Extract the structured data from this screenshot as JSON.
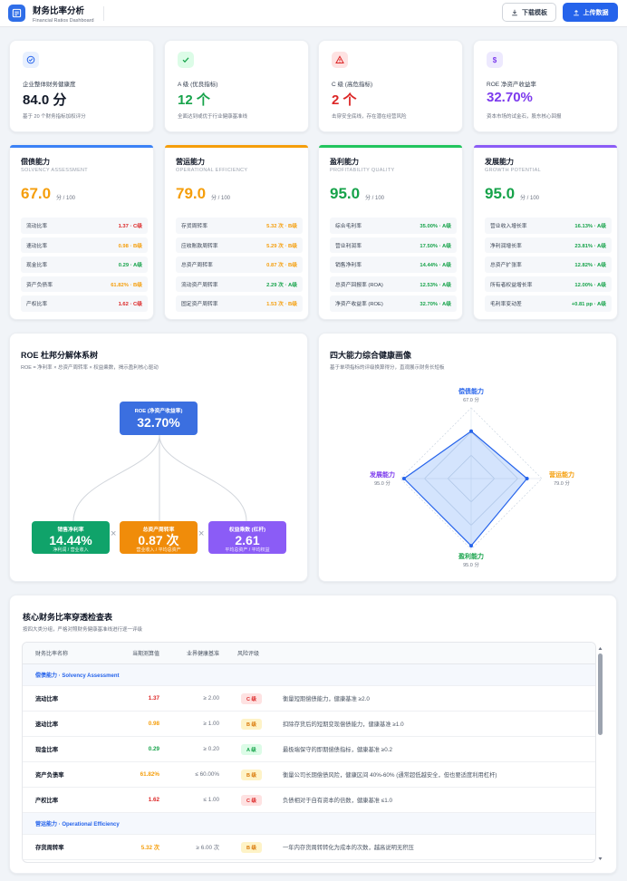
{
  "header": {
    "title": "财务比率分析",
    "subtitle": "Financial Ratios Dashboard",
    "download_label": "下载模板",
    "upload_label": "上传数据"
  },
  "kpis": [
    {
      "label": "企业整体财务健康度",
      "value": "84.0 分",
      "desc": "基于 20 个财务指标加权评分",
      "color": "#111827",
      "bg": "#e8f0fe",
      "icon": "check-circle-icon"
    },
    {
      "label": "A 级 (优良指标)",
      "value": "12 个",
      "desc": "全面达到或优于行业健康基准线",
      "color": "#16a34a",
      "bg": "#dcfce7",
      "icon": "check-icon"
    },
    {
      "label": "C 级 (高危指标)",
      "value": "2 个",
      "desc": "击穿安全底线，存在潜在经营风险",
      "color": "#dc2626",
      "bg": "#fee2e2",
      "icon": "warning-icon"
    },
    {
      "label": "ROE 净资产收益率",
      "value": "32.70%",
      "desc": "资本市场的试金石，股东核心回报",
      "color": "#7c3aed",
      "bg": "#ede9fe",
      "icon": "dollar-icon"
    }
  ],
  "dimensions": [
    {
      "name": "偿债能力",
      "en": "SOLVENCY ASSESSMENT",
      "score": "67.0",
      "per": "分 / 100",
      "color": "#f59e0b",
      "top": "#3b82f6",
      "rows": [
        {
          "name": "流动比率",
          "value": "1.37 · C级",
          "grade": "C"
        },
        {
          "name": "速动比率",
          "value": "0.98 · B级",
          "grade": "B"
        },
        {
          "name": "现金比率",
          "value": "0.29 · A级",
          "grade": "A"
        },
        {
          "name": "资产负债率",
          "value": "61.82% · B级",
          "grade": "B"
        },
        {
          "name": "产权比率",
          "value": "1.62 · C级",
          "grade": "C"
        }
      ]
    },
    {
      "name": "营运能力",
      "en": "OPERATIONAL EFFICIENCY",
      "score": "79.0",
      "per": "分 / 100",
      "color": "#f59e0b",
      "top": "#f59e0b",
      "rows": [
        {
          "name": "存货周转率",
          "value": "5.32 次 · B级",
          "grade": "B"
        },
        {
          "name": "应收账款周转率",
          "value": "5.29 次 · B级",
          "grade": "B"
        },
        {
          "name": "总资产周转率",
          "value": "0.87 次 · B级",
          "grade": "B"
        },
        {
          "name": "流动资产周转率",
          "value": "2.29 次 · A级",
          "grade": "A"
        },
        {
          "name": "固定资产周转率",
          "value": "1.53 次 · B级",
          "grade": "B"
        }
      ]
    },
    {
      "name": "盈利能力",
      "en": "PROFITABILITY QUALITY",
      "score": "95.0",
      "per": "分 / 100",
      "color": "#16a34a",
      "top": "#22c55e",
      "rows": [
        {
          "name": "综合毛利率",
          "value": "35.00% · A级",
          "grade": "A"
        },
        {
          "name": "营业利润率",
          "value": "17.50% · A级",
          "grade": "A"
        },
        {
          "name": "销售净利率",
          "value": "14.44% · A级",
          "grade": "A"
        },
        {
          "name": "总资产回报率 (ROA)",
          "value": "12.53% · A级",
          "grade": "A"
        },
        {
          "name": "净资产收益率 (ROE)",
          "value": "32.70% · A级",
          "grade": "A"
        }
      ]
    },
    {
      "name": "发展能力",
      "en": "GROWTH POTENTIAL",
      "score": "95.0",
      "per": "分 / 100",
      "color": "#16a34a",
      "top": "#8b5cf6",
      "rows": [
        {
          "name": "营业收入增长率",
          "value": "16.13% · A级",
          "grade": "A"
        },
        {
          "name": "净利润增长率",
          "value": "23.81% · A级",
          "grade": "A"
        },
        {
          "name": "总资产扩张率",
          "value": "12.82% · A级",
          "grade": "A"
        },
        {
          "name": "所有者权益增长率",
          "value": "12.00% · A级",
          "grade": "A"
        },
        {
          "name": "毛利率变动差",
          "value": "+0.81 pp · A级",
          "grade": "A"
        }
      ]
    }
  ],
  "dupont": {
    "title": "ROE 杜邦分解体系树",
    "subtitle": "ROE = 净利率 × 总资产周转率 × 权益乘数，揭示盈利核心驱动",
    "root": {
      "title": "ROE (净资产收益率)",
      "value": "32.70%"
    },
    "times": "×",
    "children": [
      {
        "title": "销售净利率",
        "value": "14.44%",
        "sub": "净利润 / 营业收入",
        "color": "#10a36a"
      },
      {
        "title": "总资产周转率",
        "value": "0.87 次",
        "sub": "营业收入 / 平均总资产",
        "color": "#f08c0a"
      },
      {
        "title": "权益乘数 (杠杆)",
        "value": "2.61",
        "sub": "平均总资产 / 平均权益",
        "color": "#8b5cf6"
      }
    ]
  },
  "radar": {
    "title": "四大能力综合健康画像",
    "subtitle": "基于单项指标的评级换算得分，直观展示财务长短板",
    "axes": [
      {
        "name": "偿债能力",
        "score": "67.0 分",
        "value": 67,
        "color": "#2563eb"
      },
      {
        "name": "营运能力",
        "score": "79.0 分",
        "value": 79,
        "color": "#f59e0b"
      },
      {
        "name": "盈利能力",
        "score": "95.0 分",
        "value": 95,
        "color": "#16a34a"
      },
      {
        "name": "发展能力",
        "score": "95.0 分",
        "value": 95,
        "color": "#7c3aed"
      }
    ]
  },
  "table": {
    "title": "核心财务比率穿透检查表",
    "subtitle": "按四大类分组，严格对照财务健康基准线进行逐一评级",
    "headers": [
      "财务比率名称",
      "当期测算值",
      "业界健康基准",
      "风险评级"
    ],
    "groups": [
      {
        "name": "偿债能力 · Solvency Assessment",
        "rows": [
          {
            "name": "流动比率",
            "value": "1.37",
            "bench": "≥ 2.00",
            "grade": "C",
            "badge": "C 级",
            "desc": "衡量短期偿债能力，健康基准 ≥2.0"
          },
          {
            "name": "速动比率",
            "value": "0.98",
            "bench": "≥ 1.00",
            "grade": "B",
            "badge": "B 级",
            "desc": "扣除存货后的短期变现偿债能力，健康基准 ≥1.0"
          },
          {
            "name": "现金比率",
            "value": "0.29",
            "bench": "≥ 0.20",
            "grade": "A",
            "badge": "A 级",
            "desc": "最极端保守的即期偿债指标，健康基准 ≥0.2"
          },
          {
            "name": "资产负债率",
            "value": "61.82%",
            "bench": "≤ 60.00%",
            "grade": "B",
            "badge": "B 级",
            "desc": "衡量公司长期偿债风险，健康区间 40%-60% (通常超低越安全，但也要适度利用杠杆)"
          },
          {
            "name": "产权比率",
            "value": "1.62",
            "bench": "≤ 1.00",
            "grade": "C",
            "badge": "C 级",
            "desc": "负债相对于自有资本的倍数，健康基准 ≤1.0"
          }
        ]
      },
      {
        "name": "营运能力 · Operational Efficiency",
        "rows": [
          {
            "name": "存货周转率",
            "value": "5.32 次",
            "bench": "≥ 6.00 次",
            "grade": "B",
            "badge": "B 级",
            "desc": "一年内存货周转转化为成本的次数，越高说明无积压"
          }
        ]
      }
    ]
  },
  "colors": {
    "A": "#16a34a",
    "B": "#f59e0b",
    "C": "#dc2626",
    "accent": "#2563eb"
  }
}
